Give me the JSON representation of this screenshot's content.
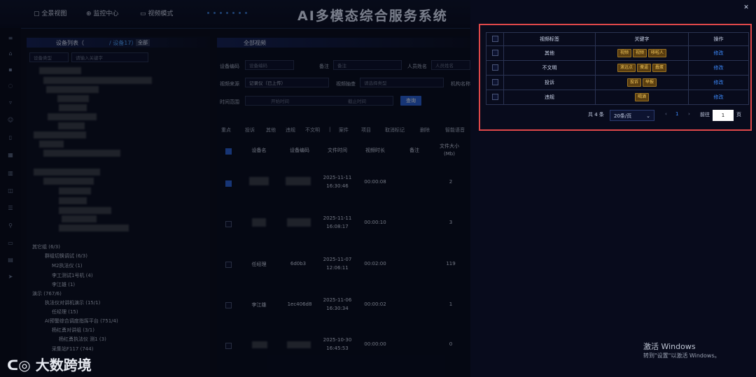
{
  "app": {
    "title": "AI多模态综合服务系统"
  },
  "topnav": [
    {
      "icon": "panorama-icon",
      "label": "全景视图"
    },
    {
      "icon": "monitor-icon",
      "label": "监控中心"
    },
    {
      "icon": "video-icon",
      "label": "视频模式"
    }
  ],
  "tree": {
    "title": "设备列表（",
    "title_count": "/ 设备17）",
    "all_btn": "全部",
    "search_type": "设备类型",
    "search_placeholder": "请输入关键字",
    "items": [
      "其它组 (6/3)",
      "群组切换调试 (6/3)",
      "M2执法仪 (1)",
      "李工测试1号机 (4)",
      "李江雄 (1)",
      "演示 (767/6)",
      "执法仪对讲机演示 (15/1)",
      "任经理 (15)",
      "AI预警综合调度指挥平台 (751/4)",
      "杨红勇对讲组 (3/1)",
      "杨红勇执法仪 测1 (3)",
      "采集站F117 (744)"
    ]
  },
  "main": {
    "panel_title": "全部视频",
    "filters": {
      "device_code_label": "设备编码",
      "device_code_ph": "设备编码",
      "note_label": "备注",
      "note_ph": "备注",
      "person_label": "人员姓名",
      "person_ph": "人员姓名",
      "source_label": "视频来源",
      "source_value": "记录仪（已上传）",
      "tag_label": "视频抽查",
      "tag_ph": "请选择类型",
      "org_label": "机构名称",
      "time_label": "时间范围",
      "start_ph": "开始时间",
      "end_ph": "截止时间",
      "query_btn": "查询"
    },
    "toolbar": [
      "重点",
      "投诉",
      "其他",
      "违规",
      "不文明",
      "|",
      "案件",
      "项目",
      "取消标记",
      "删除",
      "智能语音"
    ],
    "columns": [
      "设备名",
      "设备编码",
      "文件时间",
      "视频时长",
      "备注",
      "文件大小(Mb)"
    ],
    "rows": [
      {
        "name": "",
        "code": "",
        "time1": "2025-11-11",
        "time2": "16:30:46",
        "duration": "00:00:08",
        "size": "2",
        "checked": true
      },
      {
        "name": "",
        "code": "",
        "time1": "2025-11-11",
        "time2": "16:08:17",
        "duration": "00:00:10",
        "size": "3",
        "checked": false
      },
      {
        "name": "任经理",
        "code": "6d0b3",
        "time1": "2025-11-07",
        "time2": "12:06:11",
        "duration": "00:02:00",
        "size": "119",
        "checked": false
      },
      {
        "name": "李江雄",
        "code": "1ec406d8",
        "time1": "2025-11-06",
        "time2": "16:30:34",
        "duration": "00:00:02",
        "size": "1",
        "checked": false
      },
      {
        "name": "",
        "code": "",
        "time1": "2025-10-30",
        "time2": "16:45:53",
        "duration": "00:00:00",
        "size": "0",
        "checked": false
      }
    ]
  },
  "drawer": {
    "columns": [
      "视频标签",
      "关键字",
      "操作"
    ],
    "rows": [
      {
        "label": "其他",
        "keywords": [
          "视频",
          "视频",
          "哆啦人"
        ],
        "action": "修改"
      },
      {
        "label": "不文明",
        "keywords": [
          "滚远点",
          "傻逼",
          "蠢蛋"
        ],
        "action": "修改"
      },
      {
        "label": "投诉",
        "keywords": [
          "投诉",
          "举报"
        ],
        "action": "修改"
      },
      {
        "label": "违规",
        "keywords": [
          "喝酒"
        ],
        "action": "修改"
      }
    ],
    "pager": {
      "total": "共 4 条",
      "size": "20条/页",
      "page": "1",
      "goto": "前往",
      "goto_value": "1",
      "unit": "页"
    }
  },
  "watermark": {
    "line1": "激活 Windows",
    "line2": "转到\"设置\"以激活 Windows。"
  },
  "logo": {
    "text": "大数跨境"
  },
  "colors": {
    "accent": "#2a62d6",
    "highlight": "#e0484a",
    "tag_bg": "#5a3e10",
    "tag_text": "#f3c75a",
    "link": "#3d8bff"
  }
}
